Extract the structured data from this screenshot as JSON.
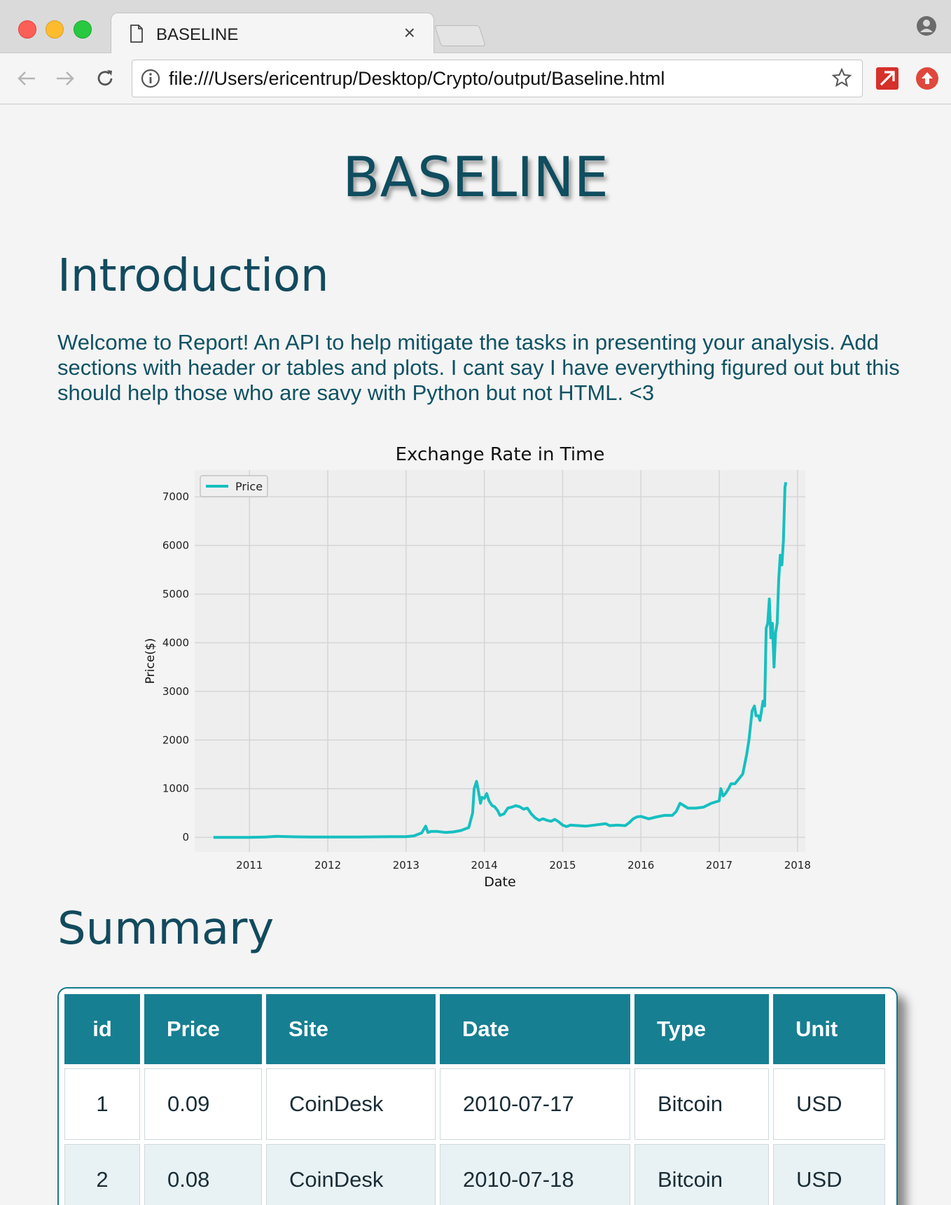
{
  "browser": {
    "tab_title": "BASELINE",
    "tab_close": "×",
    "url": "file:///Users/ericentrup/Desktop/Crypto/output/Baseline.html"
  },
  "page": {
    "title": "BASELINE",
    "intro_heading": "Introduction",
    "intro_text": "Welcome to Report! An API to help mitigate the tasks in presenting your analysis. Add sections with header or tables and plots. I cant say I have everything figured out but this should help those who are savy with Python but not HTML. <3",
    "summary_heading": "Summary"
  },
  "chart_data": {
    "type": "line",
    "title": "Exchange Rate in Time",
    "xlabel": "Date",
    "ylabel": "Price($)",
    "legend": "top-left",
    "grid": true,
    "xlim": [
      2010.3,
      2018.1
    ],
    "ylim": [
      -300,
      7550
    ],
    "x_ticks": [
      "2011",
      "2012",
      "2013",
      "2014",
      "2015",
      "2016",
      "2017",
      "2018"
    ],
    "y_ticks": [
      "0",
      "1000",
      "2000",
      "3000",
      "4000",
      "5000",
      "6000",
      "7000"
    ],
    "series": [
      {
        "name": "Price",
        "color": "#17bfc0",
        "x": [
          2010.54,
          2010.8,
          2011.0,
          2011.2,
          2011.35,
          2011.45,
          2011.6,
          2011.8,
          2012.0,
          2012.3,
          2012.6,
          2012.8,
          2013.0,
          2013.1,
          2013.2,
          2013.25,
          2013.28,
          2013.32,
          2013.4,
          2013.5,
          2013.6,
          2013.7,
          2013.8,
          2013.85,
          2013.87,
          2013.9,
          2013.93,
          2013.95,
          2013.97,
          2014.0,
          2014.03,
          2014.06,
          2014.1,
          2014.13,
          2014.17,
          2014.2,
          2014.25,
          2014.3,
          2014.35,
          2014.4,
          2014.45,
          2014.5,
          2014.55,
          2014.6,
          2014.65,
          2014.7,
          2014.75,
          2014.8,
          2014.85,
          2014.9,
          2014.95,
          2015.0,
          2015.05,
          2015.1,
          2015.2,
          2015.3,
          2015.4,
          2015.5,
          2015.55,
          2015.6,
          2015.7,
          2015.8,
          2015.85,
          2015.9,
          2015.95,
          2016.0,
          2016.1,
          2016.2,
          2016.3,
          2016.4,
          2016.45,
          2016.5,
          2016.55,
          2016.6,
          2016.7,
          2016.8,
          2016.9,
          2017.0,
          2017.02,
          2017.05,
          2017.08,
          2017.12,
          2017.15,
          2017.2,
          2017.25,
          2017.3,
          2017.35,
          2017.38,
          2017.42,
          2017.45,
          2017.47,
          2017.5,
          2017.52,
          2017.54,
          2017.56,
          2017.58,
          2017.6,
          2017.62,
          2017.64,
          2017.66,
          2017.68,
          2017.7,
          2017.72,
          2017.74,
          2017.76,
          2017.78,
          2017.8,
          2017.82,
          2017.84,
          2017.85
        ],
        "y": [
          0.09,
          0.06,
          0.3,
          5,
          20,
          15,
          10,
          5,
          5,
          6,
          10,
          13,
          13,
          30,
          90,
          230,
          100,
          120,
          120,
          100,
          110,
          140,
          200,
          500,
          1000,
          1150,
          900,
          700,
          820,
          800,
          900,
          750,
          650,
          630,
          550,
          450,
          480,
          600,
          620,
          650,
          630,
          580,
          600,
          480,
          400,
          350,
          380,
          350,
          330,
          370,
          320,
          250,
          220,
          250,
          240,
          230,
          250,
          270,
          280,
          240,
          250,
          240,
          300,
          380,
          420,
          430,
          380,
          420,
          450,
          450,
          530,
          700,
          650,
          600,
          600,
          620,
          700,
          750,
          1000,
          850,
          900,
          1000,
          1100,
          1100,
          1200,
          1300,
          1700,
          2000,
          2600,
          2700,
          2500,
          2500,
          2400,
          2600,
          2800,
          2700,
          4300,
          4400,
          4900,
          4100,
          4400,
          3500,
          4200,
          4400,
          5300,
          5800,
          5600,
          6100,
          7200,
          7300
        ]
      }
    ]
  },
  "table": {
    "columns": [
      "id",
      "Price",
      "Site",
      "Date",
      "Type",
      "Unit"
    ],
    "rows": [
      [
        "1",
        "0.09",
        "CoinDesk",
        "2010-07-17",
        "Bitcoin",
        "USD"
      ],
      [
        "2",
        "0.08",
        "CoinDesk",
        "2010-07-18",
        "Bitcoin",
        "USD"
      ]
    ]
  }
}
